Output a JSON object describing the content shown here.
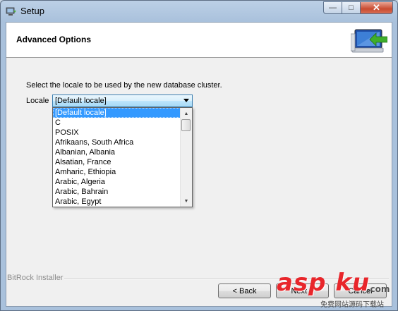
{
  "window": {
    "title": "Setup"
  },
  "header": {
    "title": "Advanced Options"
  },
  "prompt": "Select the locale to be used by the new database cluster.",
  "locale": {
    "label": "Locale",
    "selected": "[Default locale]",
    "options": [
      "[Default locale]",
      "C",
      "POSIX",
      "Afrikaans, South Africa",
      "Albanian, Albania",
      "Alsatian, France",
      "Amharic, Ethiopia",
      "Arabic, Algeria",
      "Arabic, Bahrain",
      "Arabic, Egypt"
    ]
  },
  "footer": {
    "installer_label": "BitRock Installer",
    "back_label": "< Back",
    "next_label": "Next >",
    "cancel_label": "Cancel"
  },
  "watermark": {
    "text": "asp ku",
    "sub": ".com",
    "caption": "免费网站源码下载站"
  },
  "colors": {
    "selection": "#3399ff",
    "close_button": "#c94b30",
    "watermark_red": "#e8262b"
  }
}
